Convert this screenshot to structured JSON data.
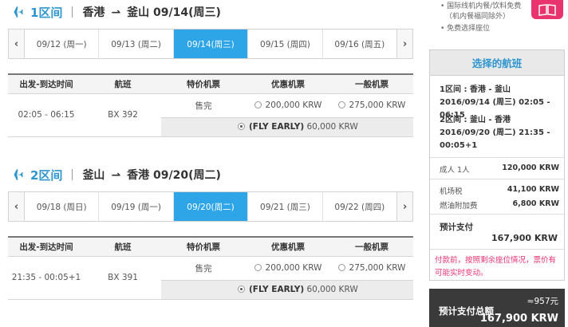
{
  "legs": [
    {
      "label": "1区间",
      "origin": "香港",
      "arrow": "⇀",
      "destination": "釜山",
      "date": "09/14(周三)",
      "prev": "‹",
      "next": "›",
      "dates": [
        "09/12 (周一)",
        "09/13 (周二)",
        "09/14(周三)",
        "09/15 (周四)",
        "09/16 (周五)"
      ],
      "active_date": 2,
      "headers": [
        "出发-到达时间",
        "航班",
        "特价机票",
        "优惠机票",
        "一般机票"
      ],
      "time": "02:05 - 06:15",
      "flight": "BX 392",
      "special": "售完",
      "discount": "200,000 KRW",
      "normal": "275,000 KRW",
      "fly_early_label": "(FLY EARLY)",
      "fly_early_price": "60,000 KRW"
    },
    {
      "label": "2区间",
      "origin": "釜山",
      "arrow": "⇀",
      "destination": "香港",
      "date": "09/20(周二)",
      "prev": "‹",
      "next": "›",
      "dates": [
        "09/18 (周日)",
        "09/19 (周一)",
        "09/20(周二)",
        "09/21 (周三)",
        "09/22 (周四)"
      ],
      "active_date": 2,
      "headers": [
        "出发-到达时间",
        "航班",
        "特价机票",
        "优惠机票",
        "一般机票"
      ],
      "time": "21:35 - 00:05+1",
      "flight": "BX 391",
      "special": "售完",
      "discount": "200,000 KRW",
      "normal": "275,000 KRW",
      "fly_early_label": "(FLY EARLY)",
      "fly_early_price": "60,000 KRW"
    }
  ],
  "promo": {
    "line1": "• 国际线机内餐/饮料免费",
    "line2": "（机内餐福同除外）",
    "line3": "• 免费选择座位"
  },
  "summary": {
    "title": "选择的航班",
    "leg1_line1": "1区间 : 香港 - 釜山",
    "leg1_line2": "2016/09/14 (周三) 02:05 - 06:15",
    "leg2_line1": "2区间 : 釜山 - 香港",
    "leg2_line2": "2016/09/20 (周二) 21:35 -",
    "leg2_line3": "00:05+1",
    "adult_label": "成人  1人",
    "adult_value": "120,000 KRW",
    "tax_label": "机场税",
    "tax_value": "41,100 KRW",
    "fuel_label": "燃油附加费",
    "fuel_value": "6,800 KRW",
    "pay_label": "预计支付",
    "pay_value": "167,900 KRW",
    "notice": "付款前，按照剩余座位情况，票价有可能实时变动。"
  },
  "total": {
    "label": "预计支付总额",
    "approx": "≈957元",
    "value": "167,900 KRW"
  },
  "colors": {
    "accent": "#2e95cf",
    "active_tab": "#2ea5e6",
    "notice": "#e8336e",
    "total_bar": "#3a3a3a"
  }
}
